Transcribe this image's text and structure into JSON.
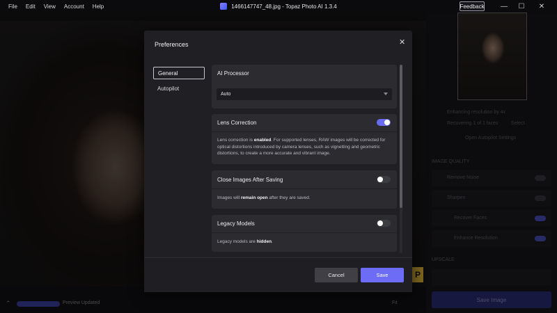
{
  "titlebar": {
    "menu": [
      "File",
      "Edit",
      "View",
      "Account",
      "Help"
    ],
    "title": "1466147747_48.jpg - Topaz Photo AI 1.3.4",
    "feedback": "Feedback",
    "minimize": "—",
    "maximize": "☐",
    "close": "✕"
  },
  "sidebar": {
    "enhancing": "Enhancing resolution by 4x",
    "recovering": "Recovering 1 of 1 faces",
    "select": "Select",
    "autopilot_settings": "Open Autopilot Settings",
    "image_quality": "IMAGE QUALITY",
    "remove_noise": "Remove Noise",
    "sharpen": "Sharpen",
    "recover_faces": "Recover Faces",
    "enhance_resolution": "Enhance Resolution",
    "upscale": "UPSCALE",
    "save_image": "Save Image"
  },
  "bottombar": {
    "status": "Preview Updated",
    "fit": "Fit"
  },
  "dialog": {
    "title": "Preferences",
    "close": "✕",
    "nav": [
      "General",
      "Autopilot"
    ],
    "ai_processor": {
      "heading": "AI Processor",
      "value": "Auto"
    },
    "lens_correction": {
      "heading": "Lens Correction",
      "enabled": true,
      "body_pre": "Lens correction is ",
      "body_bold": "enabled",
      "body_post": ". For supported lenses, RAW images will be corrected for optical distortions introduced by camera lenses, such as vignetting and geometric distortions, to create a more accurate and vibrant image."
    },
    "close_after_saving": {
      "heading": "Close Images After Saving",
      "enabled": false,
      "body_pre": "Images will ",
      "body_bold": "remain open",
      "body_post": " after they are saved."
    },
    "legacy_models": {
      "heading": "Legacy Models",
      "enabled": false,
      "body_pre": "Legacy models are ",
      "body_bold": "hidden",
      "body_post": "."
    },
    "cancel": "Cancel",
    "save": "Save"
  },
  "colors": {
    "accent": "#6d6cf6",
    "dialog_bg": "#202024",
    "card_bg": "#2b2b30"
  }
}
